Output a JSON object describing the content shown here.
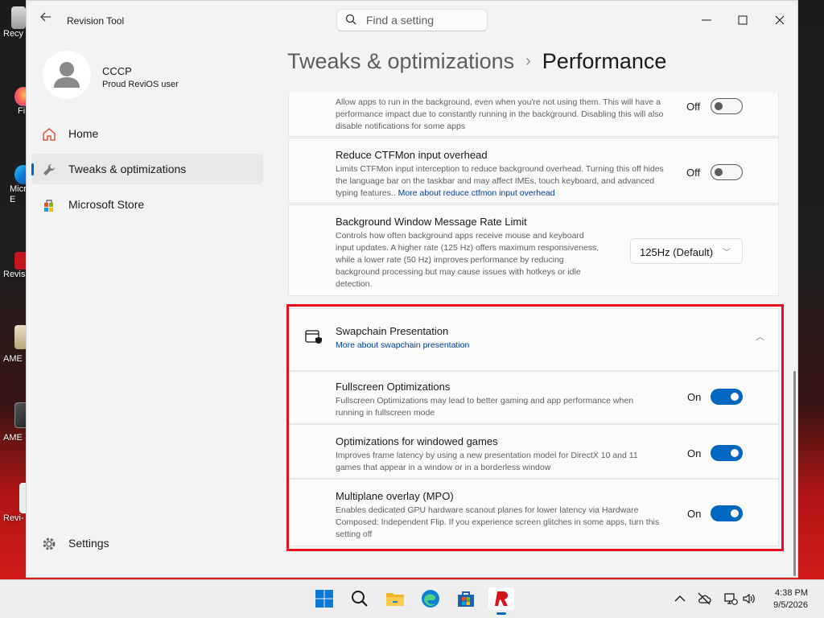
{
  "desktop": {
    "icons": [
      {
        "label": "Recy",
        "icon": "recycle-bin-icon"
      },
      {
        "label": "Fi",
        "icon": "firefox-icon"
      },
      {
        "label": "Micr E",
        "icon": "edge-icon"
      },
      {
        "label": "Revis",
        "icon": "revision-tool-icon"
      },
      {
        "label": "AME",
        "icon": "ame-icon"
      },
      {
        "label": "AME",
        "icon": "ame-icon"
      },
      {
        "label": "Revi-",
        "icon": "revi-icon"
      }
    ]
  },
  "window": {
    "title": "Revision Tool",
    "search_placeholder": "Find a setting"
  },
  "profile": {
    "name": "CCCP",
    "subtitle": "Proud ReviOS user"
  },
  "sidebar": {
    "items": [
      {
        "label": "Home",
        "icon": "home-icon",
        "selected": false
      },
      {
        "label": "Tweaks & optimizations",
        "icon": "wrench-icon",
        "selected": true
      },
      {
        "label": "Microsoft Store",
        "icon": "store-icon",
        "selected": false
      }
    ],
    "settings_label": "Settings"
  },
  "breadcrumb": {
    "parent": "Tweaks & optimizations",
    "separator": "›",
    "current": "Performance"
  },
  "settings": {
    "background_apps": {
      "description": "Allow apps to run in the background, even when you're not using them. This will have a performance impact due to constantly running in the background. Disabling this will also disable notifications for some apps",
      "state": "Off"
    },
    "ctfmon": {
      "title": "Reduce CTFMon input overhead",
      "description": "Limits CTFMon input interception to reduce background overhead. Turning this off hides the language bar on the taskbar and may affect IMEs, touch keyboard, and advanced typing features..",
      "link": "More about reduce ctfmon input overhead",
      "state": "Off"
    },
    "message_rate": {
      "title": "Background Window Message Rate Limit",
      "description": "Controls how often background apps receive mouse and keyboard input updates. A higher rate (125 Hz) offers maximum responsiveness, while a lower rate (50 Hz) improves performance by reducing background processing but may cause issues with hotkeys or idle detection.",
      "value": "125Hz (Default)"
    },
    "swapchain": {
      "title": "Swapchain Presentation",
      "link": "More about swapchain presentation",
      "items": [
        {
          "title": "Fullscreen Optimizations",
          "description": "Fullscreen Optimizations may lead to better gaming and app performance when running in fullscreen mode",
          "state": "On"
        },
        {
          "title": "Optimizations for windowed games",
          "description": "Improves frame latency by using a new presentation model for DirectX 10 and 11 games that appear in a window or in a borderless window",
          "state": "On"
        },
        {
          "title": "Multiplane overlay (MPO)",
          "description": "Enables dedicated GPU hardware scanout planes for lower latency via Hardware Composed: Independent Flip. If you experience screen glitches in some apps, turn this setting off",
          "state": "On"
        }
      ]
    }
  },
  "taskbar": {
    "time": "4:38 PM",
    "date": "9/5/2026"
  },
  "colors": {
    "accent": "#0067c0",
    "highlight": "#e81123"
  }
}
